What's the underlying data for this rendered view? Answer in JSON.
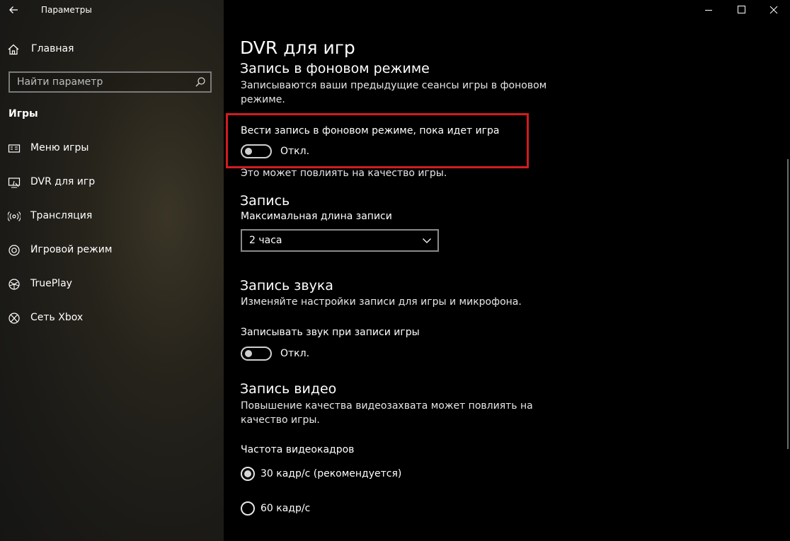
{
  "window": {
    "title": "Параметры"
  },
  "sidebar": {
    "home_label": "Главная",
    "search_placeholder": "Найти параметр",
    "section_title": "Игры",
    "items": [
      {
        "label": "Меню игры",
        "icon": "game-bar-icon"
      },
      {
        "label": "DVR для игр",
        "icon": "game-dvr-icon"
      },
      {
        "label": "Трансляция",
        "icon": "broadcast-icon"
      },
      {
        "label": "Игровой режим",
        "icon": "game-mode-icon"
      },
      {
        "label": "TruePlay",
        "icon": "trueplay-icon"
      },
      {
        "label": "Сеть Xbox",
        "icon": "xbox-icon"
      }
    ]
  },
  "main": {
    "title": "DVR для игр",
    "background_recording": {
      "heading": "Запись в фоновом режиме",
      "description": "Записываются ваши предыдущие сеансы игры в фоновом режиме.",
      "toggle_label": "Вести запись в фоновом режиме, пока идет игра",
      "toggle_state": "Откл.",
      "note": "Это может повлиять на качество игры."
    },
    "recording": {
      "heading": "Запись",
      "max_length_label": "Максимальная длина записи",
      "max_length_value": "2 часа"
    },
    "audio": {
      "heading": "Запись звука",
      "description": "Изменяйте настройки записи для игры и микрофона.",
      "toggle_label": "Записывать звук при записи игры",
      "toggle_state": "Откл."
    },
    "video": {
      "heading": "Запись видео",
      "description": "Повышение качества видеозахвата может повлиять на качество игры.",
      "framerate_label": "Частота видеокадров",
      "options": [
        {
          "label": "30 кадр/с (рекомендуется)",
          "selected": true
        },
        {
          "label": "60 кадр/с",
          "selected": false
        }
      ]
    }
  },
  "colors": {
    "highlight": "#d01d20",
    "background": "#000000"
  }
}
